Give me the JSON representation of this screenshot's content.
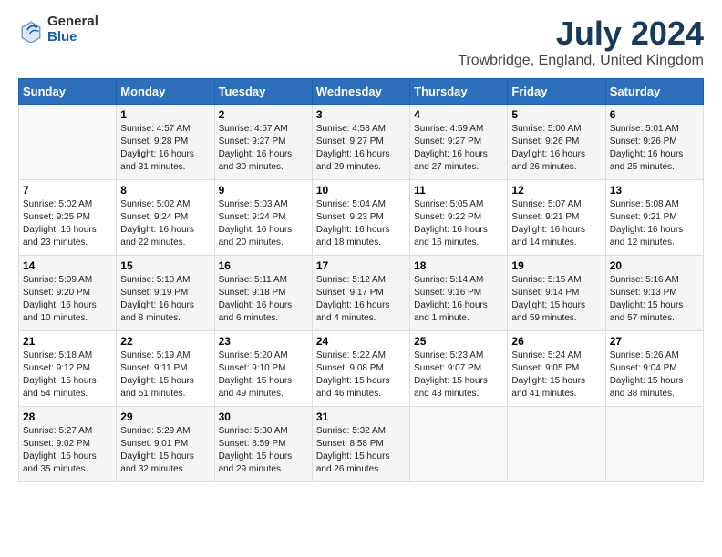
{
  "header": {
    "logo_general": "General",
    "logo_blue": "Blue",
    "month_title": "July 2024",
    "location": "Trowbridge, England, United Kingdom"
  },
  "weekdays": [
    "Sunday",
    "Monday",
    "Tuesday",
    "Wednesday",
    "Thursday",
    "Friday",
    "Saturday"
  ],
  "weeks": [
    [
      {
        "day": "",
        "info": ""
      },
      {
        "day": "1",
        "info": "Sunrise: 4:57 AM\nSunset: 9:28 PM\nDaylight: 16 hours\nand 31 minutes."
      },
      {
        "day": "2",
        "info": "Sunrise: 4:57 AM\nSunset: 9:27 PM\nDaylight: 16 hours\nand 30 minutes."
      },
      {
        "day": "3",
        "info": "Sunrise: 4:58 AM\nSunset: 9:27 PM\nDaylight: 16 hours\nand 29 minutes."
      },
      {
        "day": "4",
        "info": "Sunrise: 4:59 AM\nSunset: 9:27 PM\nDaylight: 16 hours\nand 27 minutes."
      },
      {
        "day": "5",
        "info": "Sunrise: 5:00 AM\nSunset: 9:26 PM\nDaylight: 16 hours\nand 26 minutes."
      },
      {
        "day": "6",
        "info": "Sunrise: 5:01 AM\nSunset: 9:26 PM\nDaylight: 16 hours\nand 25 minutes."
      }
    ],
    [
      {
        "day": "7",
        "info": "Sunrise: 5:02 AM\nSunset: 9:25 PM\nDaylight: 16 hours\nand 23 minutes."
      },
      {
        "day": "8",
        "info": "Sunrise: 5:02 AM\nSunset: 9:24 PM\nDaylight: 16 hours\nand 22 minutes."
      },
      {
        "day": "9",
        "info": "Sunrise: 5:03 AM\nSunset: 9:24 PM\nDaylight: 16 hours\nand 20 minutes."
      },
      {
        "day": "10",
        "info": "Sunrise: 5:04 AM\nSunset: 9:23 PM\nDaylight: 16 hours\nand 18 minutes."
      },
      {
        "day": "11",
        "info": "Sunrise: 5:05 AM\nSunset: 9:22 PM\nDaylight: 16 hours\nand 16 minutes."
      },
      {
        "day": "12",
        "info": "Sunrise: 5:07 AM\nSunset: 9:21 PM\nDaylight: 16 hours\nand 14 minutes."
      },
      {
        "day": "13",
        "info": "Sunrise: 5:08 AM\nSunset: 9:21 PM\nDaylight: 16 hours\nand 12 minutes."
      }
    ],
    [
      {
        "day": "14",
        "info": "Sunrise: 5:09 AM\nSunset: 9:20 PM\nDaylight: 16 hours\nand 10 minutes."
      },
      {
        "day": "15",
        "info": "Sunrise: 5:10 AM\nSunset: 9:19 PM\nDaylight: 16 hours\nand 8 minutes."
      },
      {
        "day": "16",
        "info": "Sunrise: 5:11 AM\nSunset: 9:18 PM\nDaylight: 16 hours\nand 6 minutes."
      },
      {
        "day": "17",
        "info": "Sunrise: 5:12 AM\nSunset: 9:17 PM\nDaylight: 16 hours\nand 4 minutes."
      },
      {
        "day": "18",
        "info": "Sunrise: 5:14 AM\nSunset: 9:16 PM\nDaylight: 16 hours\nand 1 minute."
      },
      {
        "day": "19",
        "info": "Sunrise: 5:15 AM\nSunset: 9:14 PM\nDaylight: 15 hours\nand 59 minutes."
      },
      {
        "day": "20",
        "info": "Sunrise: 5:16 AM\nSunset: 9:13 PM\nDaylight: 15 hours\nand 57 minutes."
      }
    ],
    [
      {
        "day": "21",
        "info": "Sunrise: 5:18 AM\nSunset: 9:12 PM\nDaylight: 15 hours\nand 54 minutes."
      },
      {
        "day": "22",
        "info": "Sunrise: 5:19 AM\nSunset: 9:11 PM\nDaylight: 15 hours\nand 51 minutes."
      },
      {
        "day": "23",
        "info": "Sunrise: 5:20 AM\nSunset: 9:10 PM\nDaylight: 15 hours\nand 49 minutes."
      },
      {
        "day": "24",
        "info": "Sunrise: 5:22 AM\nSunset: 9:08 PM\nDaylight: 15 hours\nand 46 minutes."
      },
      {
        "day": "25",
        "info": "Sunrise: 5:23 AM\nSunset: 9:07 PM\nDaylight: 15 hours\nand 43 minutes."
      },
      {
        "day": "26",
        "info": "Sunrise: 5:24 AM\nSunset: 9:05 PM\nDaylight: 15 hours\nand 41 minutes."
      },
      {
        "day": "27",
        "info": "Sunrise: 5:26 AM\nSunset: 9:04 PM\nDaylight: 15 hours\nand 38 minutes."
      }
    ],
    [
      {
        "day": "28",
        "info": "Sunrise: 5:27 AM\nSunset: 9:02 PM\nDaylight: 15 hours\nand 35 minutes."
      },
      {
        "day": "29",
        "info": "Sunrise: 5:29 AM\nSunset: 9:01 PM\nDaylight: 15 hours\nand 32 minutes."
      },
      {
        "day": "30",
        "info": "Sunrise: 5:30 AM\nSunset: 8:59 PM\nDaylight: 15 hours\nand 29 minutes."
      },
      {
        "day": "31",
        "info": "Sunrise: 5:32 AM\nSunset: 8:58 PM\nDaylight: 15 hours\nand 26 minutes."
      },
      {
        "day": "",
        "info": ""
      },
      {
        "day": "",
        "info": ""
      },
      {
        "day": "",
        "info": ""
      }
    ]
  ]
}
